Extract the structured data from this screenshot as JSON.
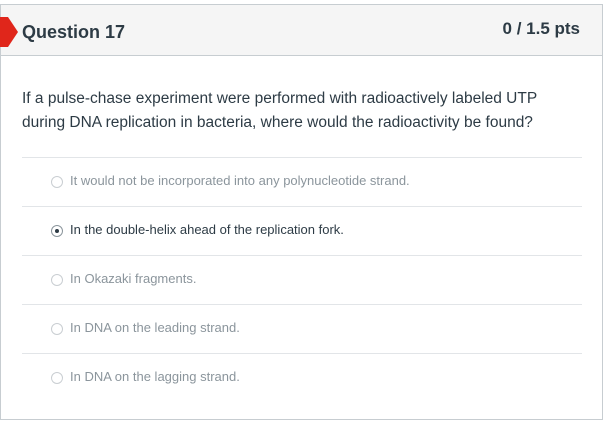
{
  "question": {
    "title": "Question 17",
    "points": "0 / 1.5 pts",
    "text": "If a pulse-chase experiment were performed with radioactively labeled UTP during DNA replication in bacteria, where would the radioactivity be found?",
    "flag_color": "#e0261b"
  },
  "answers": [
    {
      "label": "It would not be incorporated into any polynucleotide strand.",
      "selected": false
    },
    {
      "label": "In the double-helix ahead of the replication fork.",
      "selected": true
    },
    {
      "label": "In Okazaki fragments.",
      "selected": false
    },
    {
      "label": "In DNA on the leading strand.",
      "selected": false
    },
    {
      "label": "In DNA on the lagging strand.",
      "selected": false
    }
  ]
}
